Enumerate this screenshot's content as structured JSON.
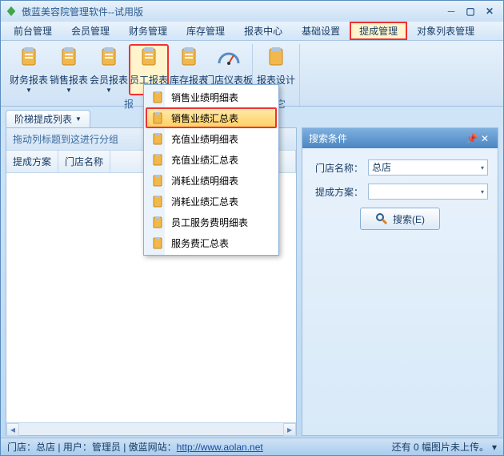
{
  "window": {
    "title": "傲蓝美容院管理软件--试用版"
  },
  "menubar": {
    "items": [
      "前台管理",
      "会员管理",
      "财务管理",
      "库存管理",
      "报表中心",
      "基础设置",
      "提成管理",
      "对象列表管理"
    ],
    "highlighted_index": 6
  },
  "ribbon": {
    "group1_label": "报",
    "group2_label": "其它",
    "buttons": [
      {
        "label": "财务报表",
        "icon": "report-finance"
      },
      {
        "label": "销售报表",
        "icon": "report-sales"
      },
      {
        "label": "会员报表",
        "icon": "report-member"
      },
      {
        "label": "员工报表",
        "icon": "report-staff",
        "highlighted": true
      },
      {
        "label": "库存报表",
        "icon": "report-stock"
      },
      {
        "label": "门店仪表板",
        "icon": "dashboard"
      }
    ],
    "button_design": {
      "label": "报表设计",
      "icon": "report-design"
    }
  },
  "tab": {
    "label": "阶梯提成列表"
  },
  "grid": {
    "group_hint": "拖动列标题到这进行分组",
    "columns": [
      "提成方案",
      "门店名称"
    ]
  },
  "dropdown": {
    "items": [
      "销售业绩明细表",
      "销售业绩汇总表",
      "充值业绩明细表",
      "充值业绩汇总表",
      "消耗业绩明细表",
      "消耗业绩汇总表",
      "员工服务费明细表",
      "服务费汇总表"
    ],
    "selected_index": 1
  },
  "search_panel": {
    "title": "搜索条件",
    "fields": {
      "store_label": "门店名称：",
      "store_value": "总店",
      "plan_label": "提成方案：",
      "plan_value": ""
    },
    "button": "搜索(E)"
  },
  "statusbar": {
    "store_prefix": "门店：",
    "store": "总店",
    "user_prefix": "用户：",
    "user": "管理员",
    "link_label": "傲蓝网站：",
    "link_url": "http://www.aolan.net",
    "right": "还有 0 幅图片未上传。"
  }
}
